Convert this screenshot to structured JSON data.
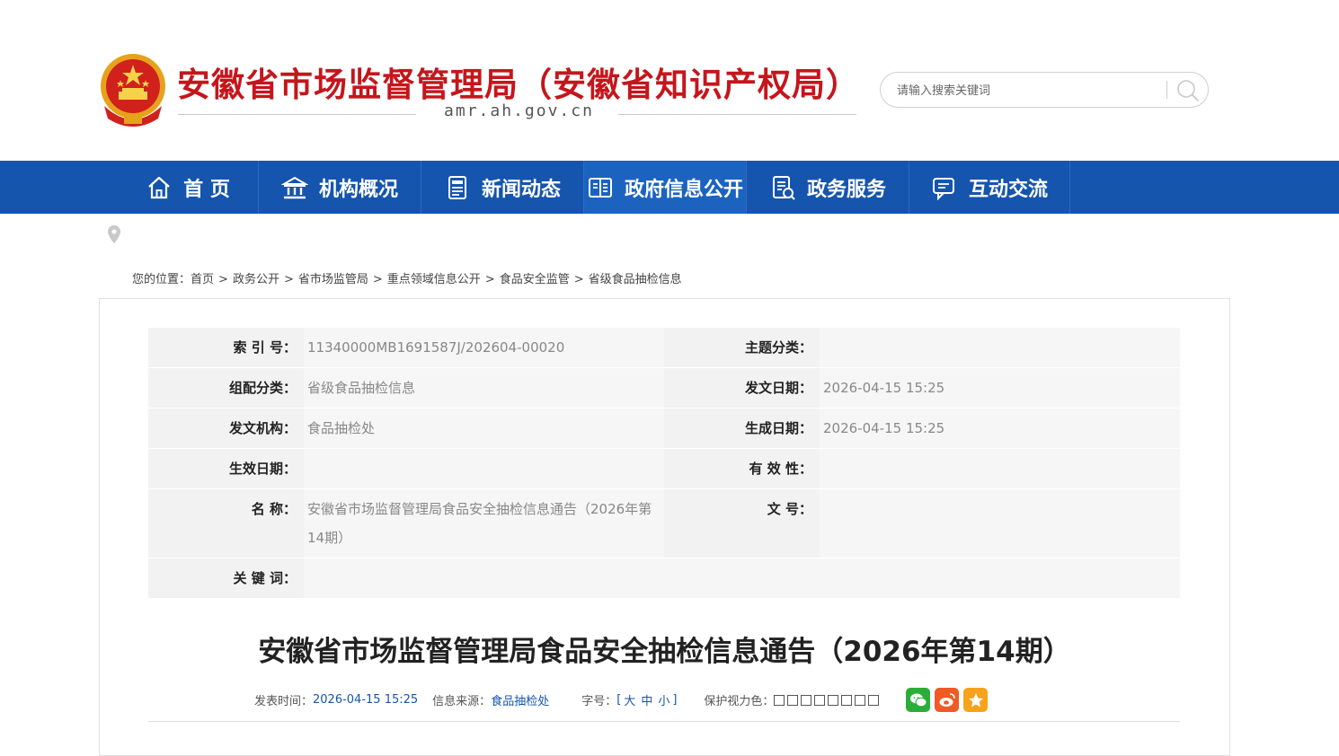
{
  "header": {
    "title": "安徽省市场监督管理局（安徽省知识产权局）",
    "domain": "amr.ah.gov.cn",
    "search": {
      "placeholder": "请输入搜索关键词"
    }
  },
  "nav": {
    "items": [
      {
        "label": "首 页",
        "icon": "home-icon"
      },
      {
        "label": "机构概况",
        "icon": "institution-icon"
      },
      {
        "label": "新闻动态",
        "icon": "news-icon"
      },
      {
        "label": "政府信息公开",
        "icon": "open-book-icon"
      },
      {
        "label": "政务服务",
        "icon": "service-document-icon"
      },
      {
        "label": "互动交流",
        "icon": "chat-icon"
      }
    ],
    "active_index": 3
  },
  "breadcrumb": {
    "prefix": "您的位置：",
    "items": [
      "首页",
      "政务公开",
      "省市场监管局",
      "重点领域信息公开",
      "食品安全监管",
      "省级食品抽检信息"
    ],
    "separator": ">"
  },
  "meta": {
    "index_no": {
      "label": "索 引 号：",
      "value": "11340000MB1691587J/202604-00020"
    },
    "topic": {
      "label": "主题分类：",
      "value": ""
    },
    "category": {
      "label": "组配分类：",
      "value": "省级食品抽检信息"
    },
    "issue_date": {
      "label": "发文日期：",
      "value": "2026-04-15 15:25"
    },
    "issuer": {
      "label": "发文机构：",
      "value": "食品抽检处"
    },
    "create_date": {
      "label": "生成日期：",
      "value": "2026-04-15 15:25"
    },
    "effective_date": {
      "label": "生效日期：",
      "value": ""
    },
    "validity": {
      "label": "有 效 性：",
      "value": ""
    },
    "name": {
      "label": "名 称：",
      "value": "安徽省市场监督管理局食品安全抽检信息通告（2026年第14期）"
    },
    "doc_no": {
      "label": "文 号：",
      "value": ""
    },
    "keywords": {
      "label": "关 键 词：",
      "value": ""
    }
  },
  "article": {
    "title": "安徽省市场监督管理局食品安全抽检信息通告（2026年第14期）",
    "publish_label": "发表时间：",
    "publish_time": "2026-04-15 15:25",
    "source_label": "信息来源：",
    "source": "食品抽检处",
    "font_label": "字号：",
    "font_open": "[",
    "font_large": "大",
    "font_medium": "中",
    "font_small": "小",
    "font_close": "]",
    "color_label": "保护视力色："
  },
  "colors": {
    "brand_red": "#c4161c",
    "nav_blue": "#1555ad",
    "wechat_green": "#2aae38",
    "weibo_orange": "#f05a25",
    "favorite_orange": "#f7a21a"
  }
}
